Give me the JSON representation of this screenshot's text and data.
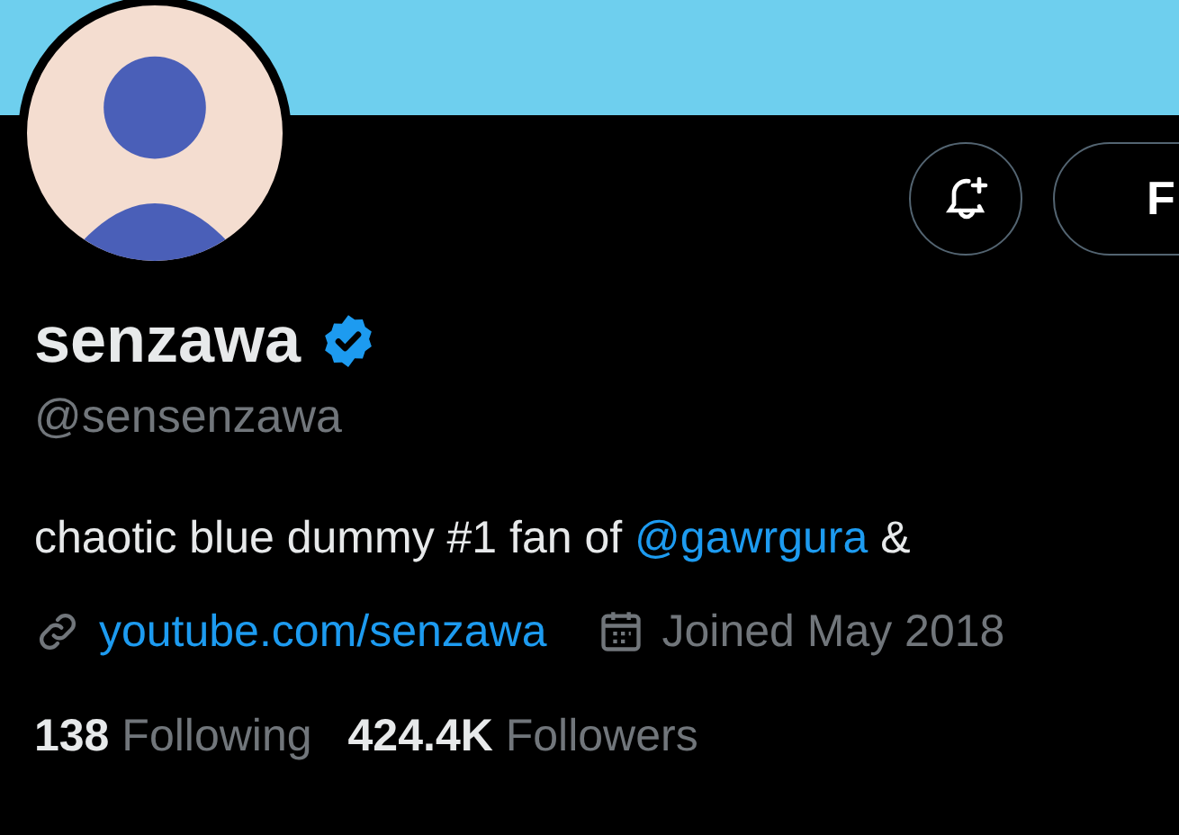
{
  "profile": {
    "name": "senzawa",
    "verified": true,
    "handle": "@sensenzawa"
  },
  "actions": {
    "follow_button": "F"
  },
  "bio": {
    "text_before": "chaotic blue dummy #1 fan of",
    "mention": "@gawrgura",
    "text_after": "&"
  },
  "meta": {
    "website": "youtube.com/senzawa",
    "joined": "Joined May 2018"
  },
  "stats": [
    {
      "count": "138",
      "label": "Following"
    },
    {
      "count": "424.4K",
      "label": "Followers"
    }
  ]
}
